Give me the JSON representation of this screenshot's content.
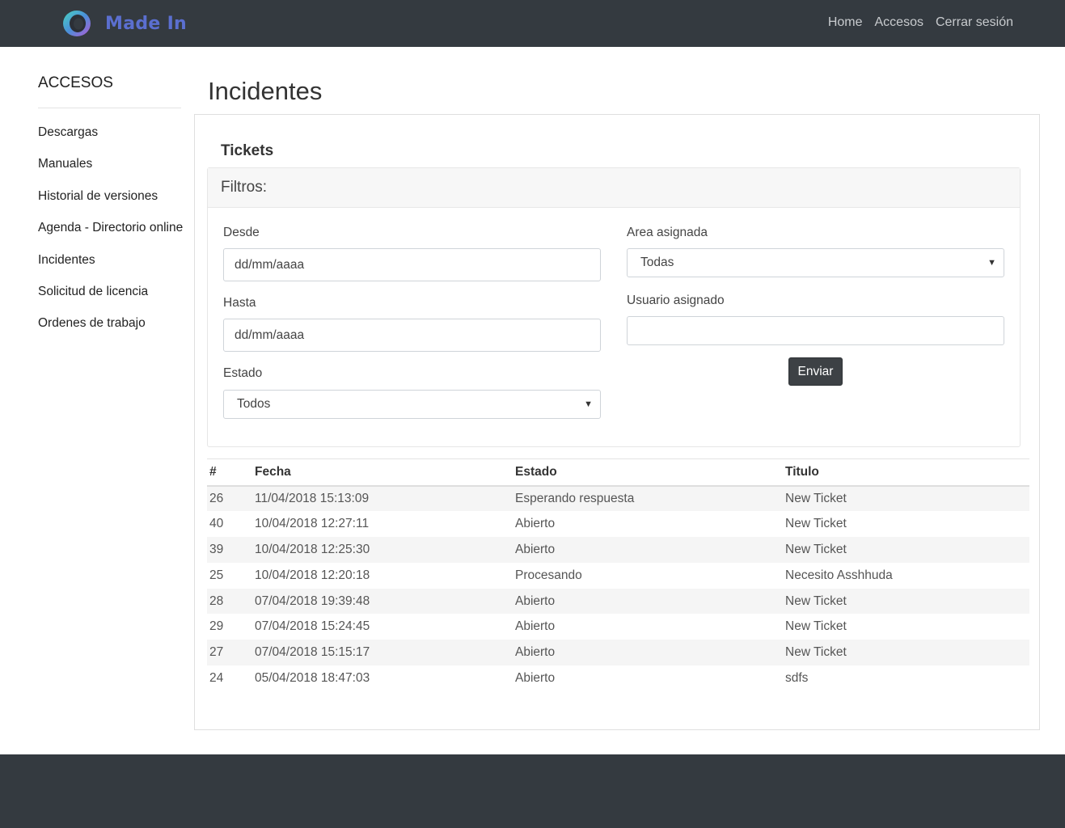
{
  "brand": {
    "name": "Made In"
  },
  "nav": {
    "links": [
      "Home",
      "Accesos",
      "Cerrar sesión"
    ]
  },
  "sidebar": {
    "title": "ACCESOS",
    "items": [
      "Descargas",
      "Manuales",
      "Historial de versiones",
      "Agenda - Directorio online",
      "Incidentes",
      "Solicitud de licencia",
      "Ordenes de trabajo"
    ]
  },
  "page": {
    "title": "Incidentes"
  },
  "tickets": {
    "title": "Tickets",
    "filters": {
      "header": "Filtros:",
      "desde_label": "Desde",
      "desde_value": "dd/mm/aaaa",
      "hasta_label": "Hasta",
      "hasta_value": "dd/mm/aaaa",
      "estado_label": "Estado",
      "estado_selected": "Todos",
      "area_label": "Area asignada",
      "area_selected": "Todas",
      "usuario_label": "Usuario asignado",
      "usuario_value": "",
      "submit_label": "Enviar"
    },
    "table": {
      "headers": [
        "#",
        "Fecha",
        "Estado",
        "Titulo"
      ],
      "rows": [
        [
          "26",
          "11/04/2018 15:13:09",
          "Esperando respuesta",
          "New Ticket"
        ],
        [
          "40",
          "10/04/2018 12:27:11",
          "Abierto",
          "New Ticket"
        ],
        [
          "39",
          "10/04/2018 12:25:30",
          "Abierto",
          "New Ticket"
        ],
        [
          "25",
          "10/04/2018 12:20:18",
          "Procesando",
          "Necesito Asshhuda"
        ],
        [
          "28",
          "07/04/2018 19:39:48",
          "Abierto",
          "New Ticket"
        ],
        [
          "29",
          "07/04/2018 15:24:45",
          "Abierto",
          "New Ticket"
        ],
        [
          "27",
          "07/04/2018 15:15:17",
          "Abierto",
          "New Ticket"
        ],
        [
          "24",
          "05/04/2018 18:47:03",
          "Abierto",
          "sdfs"
        ]
      ]
    }
  },
  "colors": {
    "navbar_bg": "#343a40",
    "brand_text": "#5b6fd0",
    "button_bg": "#3d4145",
    "stripe": "#f5f5f5"
  }
}
